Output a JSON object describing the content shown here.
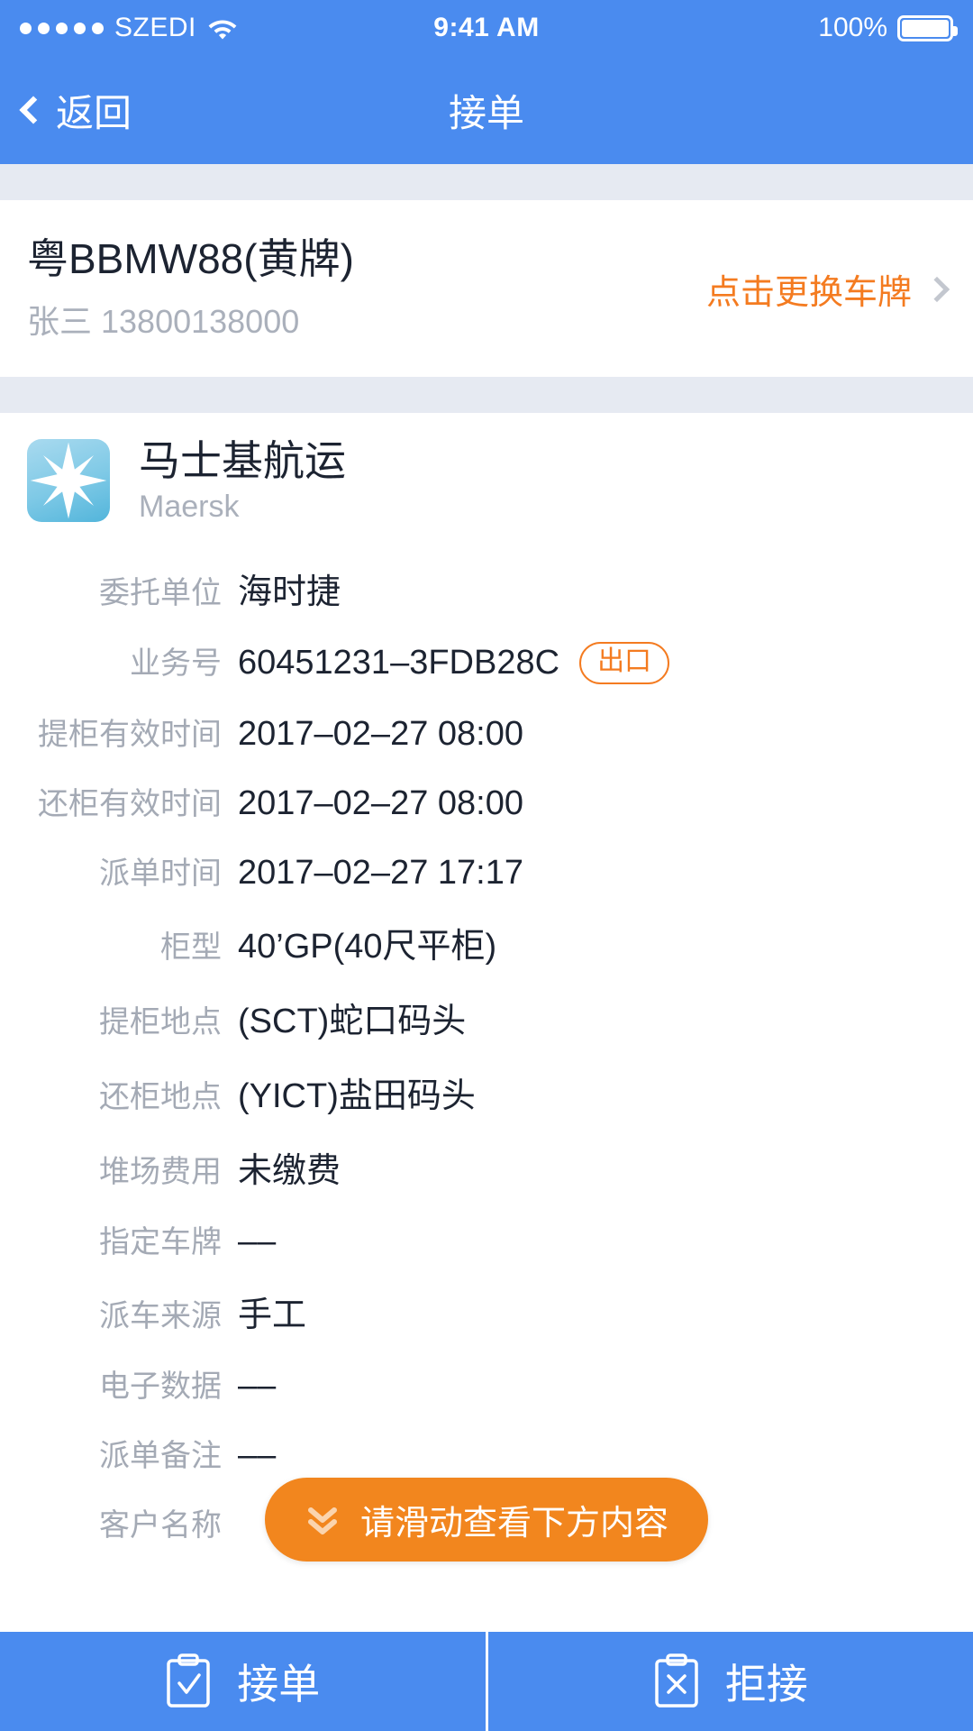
{
  "status_bar": {
    "carrier": "SZEDI",
    "signal_dots": 5,
    "wifi_icon": "wifi-icon",
    "time": "9:41 AM",
    "battery_percent": "100%",
    "battery_icon": "battery-full-icon"
  },
  "nav": {
    "back_icon": "chevron-left-icon",
    "back_label": "返回",
    "title": "接单"
  },
  "plate_card": {
    "plate_number": "粤BBMW88(黄牌)",
    "driver": "张三 13800138000",
    "action_label": "点击更换车牌",
    "action_icon": "chevron-right-icon"
  },
  "carrier_block": {
    "logo_icon": "maersk-star-logo",
    "name_cn": "马士基航运",
    "name_en": "Maersk"
  },
  "details": [
    {
      "label": "委托单位",
      "value": "海时捷"
    },
    {
      "label": "业务号",
      "value": "60451231–3FDB28C",
      "badge": "出口"
    },
    {
      "label": "提柜有效时间",
      "value": "2017–02–27 08:00"
    },
    {
      "label": "还柜有效时间",
      "value": "2017–02–27 08:00"
    },
    {
      "label": "派单时间",
      "value": "2017–02–27 17:17"
    },
    {
      "label": "柜型",
      "value": "40’GP(40尺平柜)"
    },
    {
      "label": "提柜地点",
      "value": "(SCT)蛇口码头"
    },
    {
      "label": "还柜地点",
      "value": "(YICT)盐田码头"
    },
    {
      "label": "堆场费用",
      "value": "未缴费"
    },
    {
      "label": "指定车牌",
      "value": "––"
    },
    {
      "label": "派车来源",
      "value": "手工"
    },
    {
      "label": "电子数据",
      "value": "––"
    },
    {
      "label": "派单备注",
      "value": "––"
    },
    {
      "label": "客户名称",
      "value": ""
    }
  ],
  "scroll_hint": {
    "icon": "double-chevron-down-icon",
    "label": "请滑动查看下方内容"
  },
  "bottom_bar": {
    "accept": {
      "icon": "clipboard-check-icon",
      "label": "接单"
    },
    "reject": {
      "icon": "clipboard-x-icon",
      "label": "拒接"
    }
  },
  "colors": {
    "header_blue": "#4a8bef",
    "accent_orange": "#f47b20",
    "hint_orange": "#f2861e",
    "band_gray": "#e6eaf2",
    "label_gray": "#a4aab5",
    "value_dark": "#1c2331"
  }
}
